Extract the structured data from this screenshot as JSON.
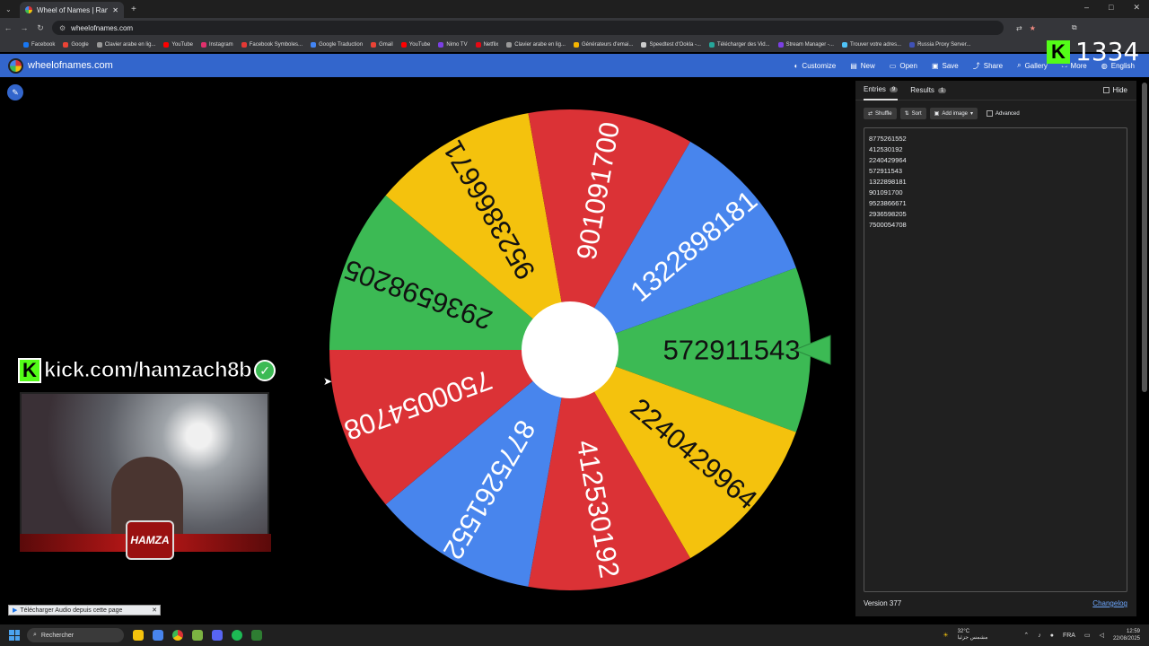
{
  "browser": {
    "tab_title": "Wheel of Names | Random",
    "url": "wheelofnames.com",
    "window_controls": [
      "–",
      "□",
      "✕"
    ],
    "bookmarks": [
      {
        "label": "Facebook",
        "color": "#1877f2"
      },
      {
        "label": "Google",
        "color": "#ea4335"
      },
      {
        "label": "Clavier arabe en lig...",
        "color": "#999999"
      },
      {
        "label": "YouTube",
        "color": "#ff0000"
      },
      {
        "label": "Instagram",
        "color": "#e1306c"
      },
      {
        "label": "Facebook Symboles...",
        "color": "#e53935"
      },
      {
        "label": "Google Traduction",
        "color": "#4285f4"
      },
      {
        "label": "Gmail",
        "color": "#ea4335"
      },
      {
        "label": "YouTube",
        "color": "#ff0000"
      },
      {
        "label": "Nimo TV",
        "color": "#7b3fe4"
      },
      {
        "label": "Netflix",
        "color": "#e50914"
      },
      {
        "label": "Clavier arabe en lig...",
        "color": "#999999"
      },
      {
        "label": "Générateurs d'emai...",
        "color": "#f4b400"
      },
      {
        "label": "Speedtest d'Ookla -...",
        "color": "#cccccc"
      },
      {
        "label": "Télécharger des Vid...",
        "color": "#26a69a"
      },
      {
        "label": "Stream Manager -...",
        "color": "#7b3fe4"
      },
      {
        "label": "Trouver votre adres...",
        "color": "#4fc3f7"
      },
      {
        "label": "Russia Proxy Server...",
        "color": "#3f51b5"
      }
    ]
  },
  "app": {
    "site_name": "wheelofnames.com",
    "menu": [
      {
        "label": "Customize",
        "icon": "palette-icon"
      },
      {
        "label": "New",
        "icon": "file-icon"
      },
      {
        "label": "Open",
        "icon": "folder-icon"
      },
      {
        "label": "Save",
        "icon": "save-icon"
      },
      {
        "label": "Share",
        "icon": "share-icon"
      },
      {
        "label": "Gallery",
        "icon": "search-icon"
      },
      {
        "label": "More",
        "icon": "fullscreen-icon"
      },
      {
        "label": "English",
        "icon": "globe-icon"
      }
    ]
  },
  "wheel": {
    "slices": [
      {
        "label": "572911543",
        "color": "#3cba54"
      },
      {
        "label": "2240429964",
        "color": "#f4c20d"
      },
      {
        "label": "412530192",
        "color": "#db3236"
      },
      {
        "label": "8775261552",
        "color": "#4885ed"
      },
      {
        "label": "7500054708",
        "color": "#db3236"
      },
      {
        "label": "2936598205",
        "color": "#3cba54"
      },
      {
        "label": "9523866671",
        "color": "#f4c20d"
      },
      {
        "label": "901091700",
        "color": "#db3236"
      },
      {
        "label": "1322898181",
        "color": "#4885ed"
      }
    ],
    "pointer_color": "#3cba54"
  },
  "panel": {
    "tab_entries": "Entries",
    "entries_count": "9",
    "tab_results": "Results",
    "results_count": "1",
    "hide_label": "Hide",
    "shuffle_label": "Shuffle",
    "sort_label": "Sort",
    "add_image_label": "Add image",
    "advanced_label": "Advanced",
    "entries": [
      "8775261552",
      "412530192",
      "2240429964",
      "572911543",
      "1322898181",
      "901091700",
      "9523866671",
      "2936598205",
      "7500054708"
    ],
    "version": "Version 377",
    "changelog": "Changelog"
  },
  "overlay": {
    "kick_count": "1334",
    "kick_banner": "kick.com/hamzach8b",
    "logo_text": "HAMZA",
    "download_bar": "Télécharger Audio depuis cette page"
  },
  "taskbar": {
    "search_placeholder": "Rechercher",
    "temperature": "32°C",
    "weather_desc": "مشمس جزئيا",
    "language": "FRA",
    "time": "12:59",
    "date": "22/08/2025"
  }
}
